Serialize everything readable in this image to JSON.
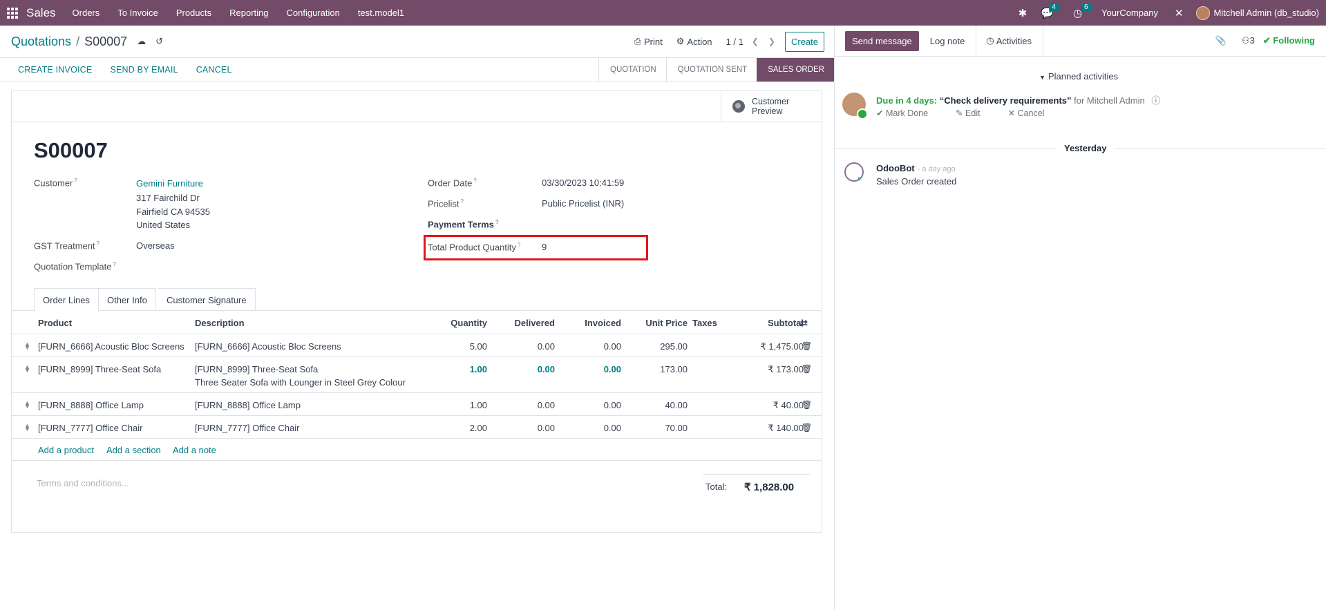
{
  "navbar": {
    "brand": "Sales",
    "menu": [
      "Orders",
      "To Invoice",
      "Products",
      "Reporting",
      "Configuration",
      "test.model1"
    ],
    "messages_count": "4",
    "activities_count": "6",
    "company": "YourCompany",
    "user": "Mitchell Admin (db_studio)"
  },
  "control_panel": {
    "breadcrumb_parent": "Quotations",
    "breadcrumb_current": "S00007",
    "print": "Print",
    "action": "Action",
    "pager": "1 / 1",
    "create": "Create"
  },
  "statusbar": {
    "buttons": [
      "CREATE INVOICE",
      "SEND BY EMAIL",
      "CANCEL"
    ],
    "stages": [
      "QUOTATION",
      "QUOTATION SENT",
      "SALES ORDER"
    ],
    "active_stage": "SALES ORDER"
  },
  "form": {
    "preview_line1": "Customer",
    "preview_line2": "Preview",
    "title": "S00007",
    "customer_label": "Customer",
    "customer_name": "Gemini Furniture",
    "customer_address": [
      "317 Fairchild Dr",
      "Fairfield CA 94535",
      "United States"
    ],
    "gst_label": "GST Treatment",
    "gst_value": "Overseas",
    "template_label": "Quotation Template",
    "order_date_label": "Order Date",
    "order_date": "03/30/2023 10:41:59",
    "pricelist_label": "Pricelist",
    "pricelist": "Public Pricelist (INR)",
    "payment_terms_label": "Payment Terms",
    "total_qty_label": "Total Product Quantity",
    "total_qty": "9"
  },
  "tabs": [
    "Order Lines",
    "Other Info",
    "Customer Signature"
  ],
  "table": {
    "headers": {
      "product": "Product",
      "description": "Description",
      "quantity": "Quantity",
      "delivered": "Delivered",
      "invoiced": "Invoiced",
      "unit_price": "Unit Price",
      "taxes": "Taxes",
      "subtotal": "Subtotal"
    },
    "rows": [
      {
        "product": "[FURN_6666] Acoustic Bloc Screens",
        "description": "[FURN_6666] Acoustic Bloc Screens",
        "description2": "",
        "quantity": "5.00",
        "delivered": "0.00",
        "invoiced": "0.00",
        "unit_price": "295.00",
        "subtotal": "₹ 1,475.00"
      },
      {
        "product": "[FURN_8999] Three-Seat Sofa",
        "description": "[FURN_8999] Three-Seat Sofa",
        "description2": "Three Seater Sofa with Lounger in Steel Grey Colour",
        "quantity": "1.00",
        "delivered": "0.00",
        "invoiced": "0.00",
        "unit_price": "173.00",
        "subtotal": "₹ 173.00"
      },
      {
        "product": "[FURN_8888] Office Lamp",
        "description": "[FURN_8888] Office Lamp",
        "description2": "",
        "quantity": "1.00",
        "delivered": "0.00",
        "invoiced": "0.00",
        "unit_price": "40.00",
        "subtotal": "₹ 40.00"
      },
      {
        "product": "[FURN_7777] Office Chair",
        "description": "[FURN_7777] Office Chair",
        "description2": "",
        "quantity": "2.00",
        "delivered": "0.00",
        "invoiced": "0.00",
        "unit_price": "70.00",
        "subtotal": "₹ 140.00"
      }
    ],
    "add_product": "Add a product",
    "add_section": "Add a section",
    "add_note": "Add a note"
  },
  "footer": {
    "terms_placeholder": "Terms and conditions...",
    "total_label": "Total:",
    "total_value": "₹ 1,828.00"
  },
  "chatter": {
    "send_message": "Send message",
    "log_note": "Log note",
    "activities": "Activities",
    "followers_count": "3",
    "following": "Following",
    "planned_activities": "Planned activities",
    "due": "Due in 4 days:",
    "summary": "“Check delivery requirements”",
    "for_user": "for Mitchell Admin",
    "mark_done": "Mark Done",
    "edit": "Edit",
    "cancel": "Cancel",
    "yesterday": "Yesterday",
    "bot_name": "OdooBot",
    "bot_time": "- a day ago",
    "bot_message": "Sales Order created"
  }
}
